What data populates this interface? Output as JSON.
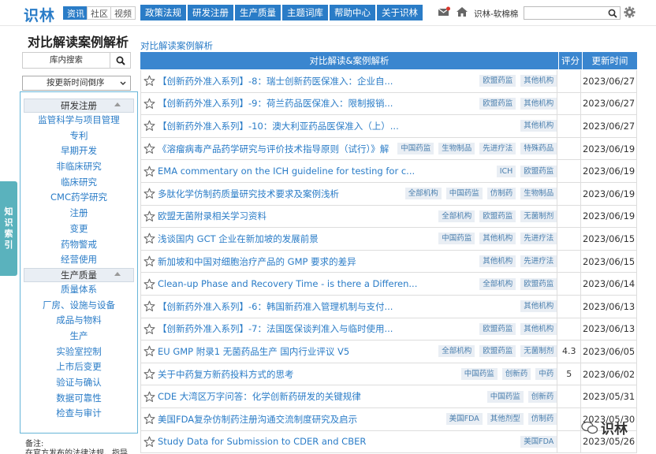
{
  "header": {
    "logo": "识林",
    "channels": [
      "资讯",
      "社区",
      "视频"
    ],
    "nav": [
      "政策法规",
      "研发注册",
      "生产质量",
      "主题词库",
      "帮助中心",
      "关于识林"
    ],
    "user": "识林-软棉棉"
  },
  "page": {
    "title": "对比解读案例解析",
    "subtitle": "对比解读案例解析"
  },
  "side": {
    "search_label": "库内搜索",
    "sort_label": "按更新时间倒序",
    "tab_label": "知识索引",
    "groups": [
      {
        "title": "研发注册",
        "items": [
          "监管科学与项目管理",
          "专利",
          "早期开发",
          "非临床研究",
          "临床研究",
          "CMC药学研究",
          "注册",
          "变更",
          "药物警戒",
          "经营使用"
        ]
      },
      {
        "title": "生产质量",
        "items": [
          "质量体系",
          "厂房、设施与设备",
          "成品与物料",
          "生产",
          "实验室控制",
          "上市后变更",
          "验证与确认",
          "数据可靠性",
          "检查与审计"
        ]
      }
    ],
    "notes_label": "备注:",
    "notes_text": "在官方发布的法律法规、指导"
  },
  "table": {
    "headers": [
      "对比解读&案例解析",
      "评分",
      "更新时间"
    ],
    "rows": [
      {
        "title": "【创新药外准入系列】-8：瑞士创新药医保准入：企业自...",
        "tags": [
          "欧盟药监",
          "其他机构"
        ],
        "score": "",
        "date": "2023/06/27"
      },
      {
        "title": "【创新药外准入系列】-9：荷兰药品医保准入：限制报销...",
        "tags": [
          "欧盟药监",
          "其他机构"
        ],
        "score": "",
        "date": "2023/06/27"
      },
      {
        "title": "【创新药外准入系列】-10：澳大利亚药品医保准入（上）...",
        "tags": [
          "其他机构"
        ],
        "score": "",
        "date": "2023/06/27"
      },
      {
        "title": "《溶瘤病毒产品药学研究与评价技术指导原则（试行）》解读",
        "tags": [
          "中国药监",
          "生物制品",
          "先进疗法",
          "特殊药品"
        ],
        "score": "",
        "date": "2023/06/19"
      },
      {
        "title": "EMA commentary on the ICH guideline for testing for c...",
        "tags": [
          "ICH",
          "欧盟药监"
        ],
        "score": "",
        "date": "2023/06/19"
      },
      {
        "title": "多肽化学仿制药质量研究技术要求及案例浅析",
        "tags": [
          "全部机构",
          "中国药监",
          "仿制药",
          "生物制品"
        ],
        "score": "",
        "date": "2023/06/19"
      },
      {
        "title": "欧盟无菌附录相关学习资料",
        "tags": [
          "全部机构",
          "欧盟药监",
          "无菌制剂"
        ],
        "score": "",
        "date": "2023/06/19"
      },
      {
        "title": "浅谈国内 GCT 企业在新加坡的发展前景",
        "tags": [
          "中国药监",
          "其他机构",
          "先进疗法"
        ],
        "score": "",
        "date": "2023/06/15"
      },
      {
        "title": "新加坡和中国对细胞治疗产品的 GMP 要求的差异",
        "tags": [
          "其他机构",
          "先进疗法"
        ],
        "score": "",
        "date": "2023/06/15"
      },
      {
        "title": "Clean-up Phase and Recovery Time - is there a Differen...",
        "tags": [
          "全部机构",
          "欧盟药监"
        ],
        "score": "",
        "date": "2023/06/14"
      },
      {
        "title": "【创新药外准入系列】-6：韩国新药准入管理机制与支付...",
        "tags": [
          "其他机构"
        ],
        "score": "",
        "date": "2023/06/13"
      },
      {
        "title": "【创新药外准入系列】-7：法国医保谈判准入与临时使用...",
        "tags": [
          "欧盟药监",
          "其他机构"
        ],
        "score": "",
        "date": "2023/06/13"
      },
      {
        "title": "EU GMP 附录1 无菌药品生产 国内行业评议 V5",
        "tags": [
          "全部机构",
          "欧盟药监",
          "无菌制剂"
        ],
        "score": "4.3",
        "date": "2023/06/05"
      },
      {
        "title": "关于中药复方新药投料方式的思考",
        "tags": [
          "中国药监",
          "创新药",
          "中药"
        ],
        "score": "5",
        "date": "2023/06/02"
      },
      {
        "title": "CDE 大湾区万字问答：化学创新药研发的关键规律",
        "tags": [
          "中国药监",
          "创新药"
        ],
        "score": "",
        "date": "2023/05/31"
      },
      {
        "title": "美国FDA复杂仿制药注册沟通交流制度研究及启示",
        "tags": [
          "美国FDA",
          "其他剂型",
          "仿制药"
        ],
        "score": "",
        "date": "2023/05/30"
      },
      {
        "title": "Study Data for Submission to CDER and CBER",
        "tags": [
          "美国FDA"
        ],
        "score": "",
        "date": "2023/05/26"
      }
    ]
  },
  "watermark": "识林"
}
